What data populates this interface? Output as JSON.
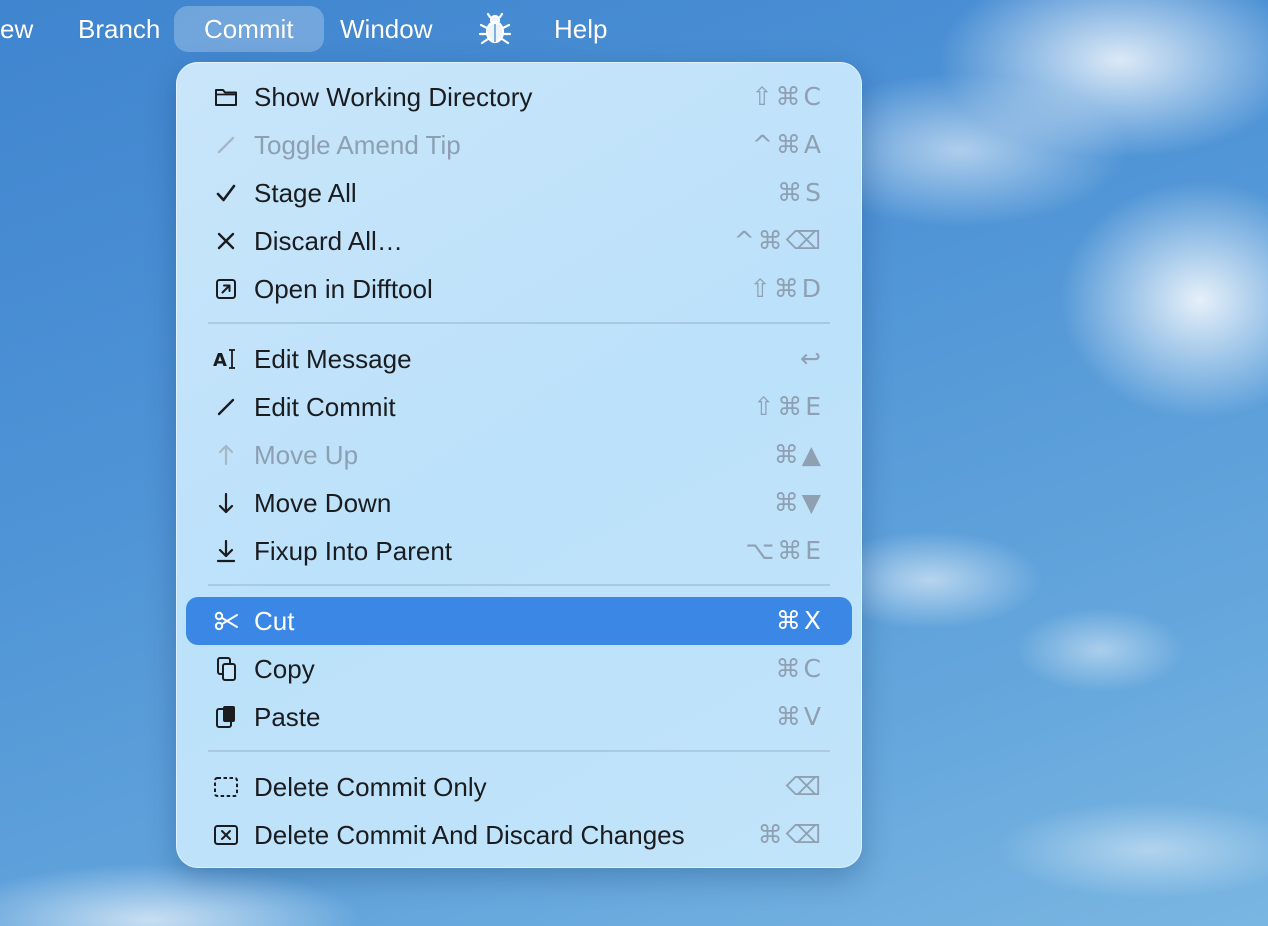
{
  "menubar": {
    "items": [
      {
        "label": "ew"
      },
      {
        "label": "Branch"
      },
      {
        "label": "Commit"
      },
      {
        "label": "Window"
      },
      {
        "label": "Help"
      }
    ],
    "bug_icon": "bug-icon"
  },
  "menu": {
    "items": [
      {
        "label": "Show Working Directory",
        "shortcut": "⇧⌘C",
        "icon": "folder-icon",
        "enabled": true
      },
      {
        "label": "Toggle Amend Tip",
        "shortcut": "^⌘A",
        "icon": "pencil-icon",
        "enabled": false
      },
      {
        "label": "Stage All",
        "shortcut": "⌘S",
        "icon": "checkmark-icon",
        "enabled": true
      },
      {
        "label": "Discard All…",
        "shortcut": "^⌘⌫",
        "icon": "xmark-icon",
        "enabled": true
      },
      {
        "label": "Open in Difftool",
        "shortcut": "⇧⌘D",
        "icon": "arrow-up-right-square-icon",
        "enabled": true
      },
      {
        "label": "Edit Message",
        "shortcut": "↩",
        "icon": "text-cursor-icon",
        "enabled": true
      },
      {
        "label": "Edit Commit",
        "shortcut": "⇧⌘E",
        "icon": "pencil-icon",
        "enabled": true
      },
      {
        "label": "Move Up",
        "shortcut": "⌘▲",
        "icon": "arrow-up-icon",
        "enabled": false
      },
      {
        "label": "Move Down",
        "shortcut": "⌘▼",
        "icon": "arrow-down-icon",
        "enabled": true
      },
      {
        "label": "Fixup Into Parent",
        "shortcut": "⌥⌘E",
        "icon": "arrow-down-to-line-icon",
        "enabled": true
      },
      {
        "label": "Cut",
        "shortcut": "⌘X",
        "icon": "scissors-icon",
        "enabled": true,
        "highlighted": true
      },
      {
        "label": "Copy",
        "shortcut": "⌘C",
        "icon": "copy-icon",
        "enabled": true
      },
      {
        "label": "Paste",
        "shortcut": "⌘V",
        "icon": "paste-icon",
        "enabled": true
      },
      {
        "label": "Delete Commit Only",
        "shortcut": "⌫",
        "icon": "dashed-square-icon",
        "enabled": true
      },
      {
        "label": "Delete Commit And Discard Changes",
        "shortcut": "⌘⌫",
        "icon": "xmark-square-icon",
        "enabled": true
      }
    ]
  },
  "colors": {
    "highlight": "#3a87e6",
    "menu_text": "#1a1c1f",
    "disabled_text": "#8da0b2"
  }
}
